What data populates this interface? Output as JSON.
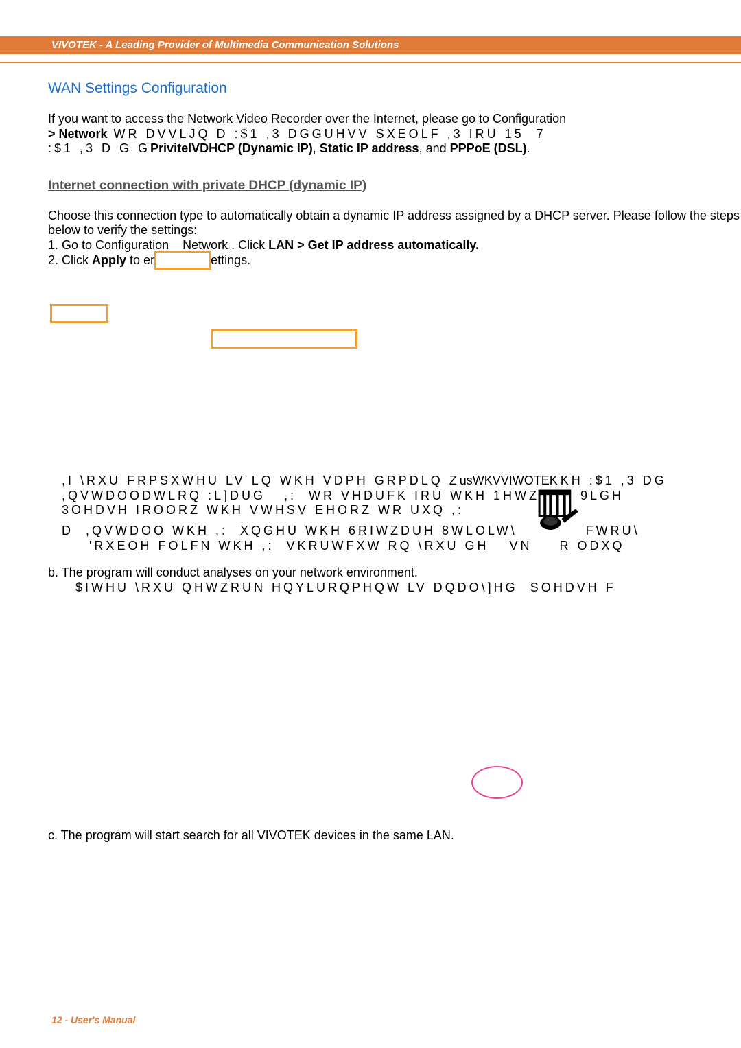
{
  "header": {
    "brand": "VIVOTEK - A Leading Provider of Multimedia Communication Solutions"
  },
  "section": {
    "title": "WAN Settings Configuration",
    "p1_line1": "If you want to access the Network Video Recorder over the Internet, please go to Configuration",
    "p1_line2a": "> Network",
    "p1_line2b": " WR DVVLJQ D :$1 ,3 DGGUHVV SXEOLF ,3 IRU 15",
    "p1_line2c": "  7",
    "p1_line3a": ":$1 ,3 D G G",
    "p1_line3b": "PrivitelVDHCP (Dynamic IP)",
    "p1_line3c": ", ",
    "p1_line3d": "Static IP address",
    "p1_line3e": ", and ",
    "p1_line3f": "PPPoE (DSL)",
    "p1_line3g": "."
  },
  "sub": {
    "title": "Internet connection with private DHCP (dynamic IP)",
    "p1": "Choose this connection type to automatically obtain a dynamic IP address assigned by a DHCP server. Please follow the steps below to verify the settings:",
    "s1a": "1. Go to Configuration    Network . Click ",
    "s1b": "LAN > Get IP address automatically.",
    "s2a": "2. Click ",
    "s2b": "Apply",
    "s2c": " to enable the settings."
  },
  "mid": {
    "l1a": ",I \\RXU FRPSXWHU LV LQ WKH VDPH GRPDLQ Z",
    "l1b": "usWKVVIWOTE",
    "l1c": "KKH :$1 ,3 DG",
    "l2": ",QVWDOODWLRQ :L]DUG   ,:  WR VHDUFK IRU WKH 1HWZRUN 9LGH",
    "l3": "3OHDVH IROORZ WKH VWHSV EHORZ WR UXQ ,:",
    "la": "D  ,QVWDOO WKH ,:  XQGHU WKH 6RIWZDUH 8WLOLW\\",
    "la2": "FWRU\\",
    "lb": "'RXEOH FOLFN WKH ,:  VKRUWFXW RQ \\RXU GH",
    "lb2": "VN",
    "lb3": "R ODXQ"
  },
  "pb": {
    "b": "b. The program will conduct analyses on your network environment.",
    "b2": "$IWHU \\RXU QHWZRUN HQYLURQPHQW LV DQDO\\]HG  SOHDVH F"
  },
  "pc": {
    "c": "c. The program will start search for all VIVOTEK devices in the same LAN."
  },
  "footer": {
    "text": "12 - User's Manual"
  }
}
